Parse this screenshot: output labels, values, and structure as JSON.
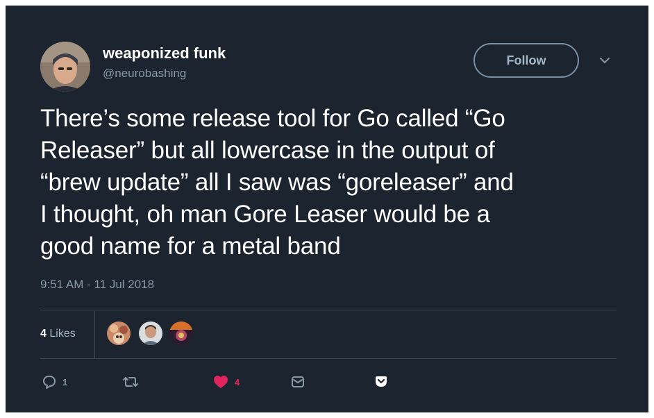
{
  "author": {
    "display_name": "weaponized funk",
    "handle": "@neurobashing"
  },
  "follow_button": {
    "label": "Follow"
  },
  "tweet": {
    "lines": [
      "There’s some release tool for Go called “Go",
      "Releaser” but all lowercase in the output of",
      "“brew update” all I saw was “goreleaser” and",
      "I thought, oh man Gore Leaser would be a",
      "good name for a metal band"
    ],
    "timestamp": "9:51 AM - 11 Jul 2018"
  },
  "stats": {
    "likes_number": "4",
    "likes_label": "Likes"
  },
  "actions": {
    "reply_count": "1",
    "retweet_count": "",
    "like_count": "4"
  },
  "icons": {
    "reply": "reply-icon",
    "retweet": "retweet-icon",
    "like": "heart-icon",
    "message": "direct-message-icon",
    "pocket": "pocket-icon",
    "more": "chevron-down-icon"
  },
  "colors": {
    "background": "#1c2430",
    "text": "#ffffff",
    "secondary": "#8899a6",
    "like": "#e0245e",
    "follow_border": "#7a8fa3"
  }
}
